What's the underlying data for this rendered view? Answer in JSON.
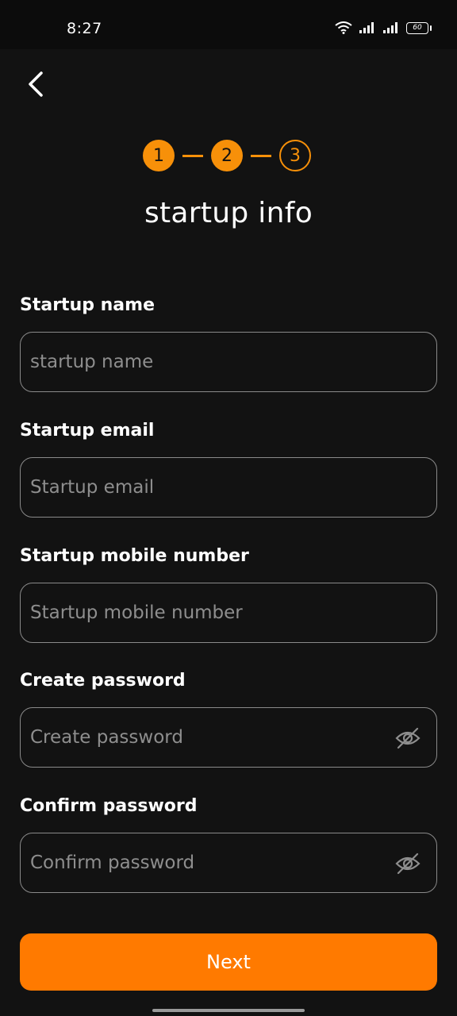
{
  "status_bar": {
    "time": "8:27",
    "battery": "60",
    "icons": [
      "wifi-icon",
      "signal-icon",
      "signal-icon",
      "battery-icon"
    ]
  },
  "header": {
    "back_icon": "chevron-left-icon"
  },
  "stepper": {
    "steps": [
      {
        "label": "1",
        "state": "completed"
      },
      {
        "label": "2",
        "state": "completed"
      },
      {
        "label": "3",
        "state": "pending"
      }
    ],
    "accent_color": "#f79009"
  },
  "title": "startup info",
  "form": {
    "fields": [
      {
        "label": "Startup name",
        "placeholder": "startup name",
        "value": ""
      },
      {
        "label": "Startup email",
        "placeholder": "Startup email",
        "value": ""
      },
      {
        "label": "Startup mobile number",
        "placeholder": "Startup mobile number",
        "value": ""
      },
      {
        "label": "Create password",
        "placeholder": "Create password",
        "value": "",
        "toggle_icon": "eye-off-icon"
      },
      {
        "label": "Confirm password",
        "placeholder": "Confirm password",
        "value": "",
        "toggle_icon": "eye-off-icon"
      }
    ]
  },
  "next_button": {
    "label": "Next",
    "color": "#ff7a00"
  },
  "colors": {
    "background": "#121212",
    "accent": "#ff7a00"
  }
}
